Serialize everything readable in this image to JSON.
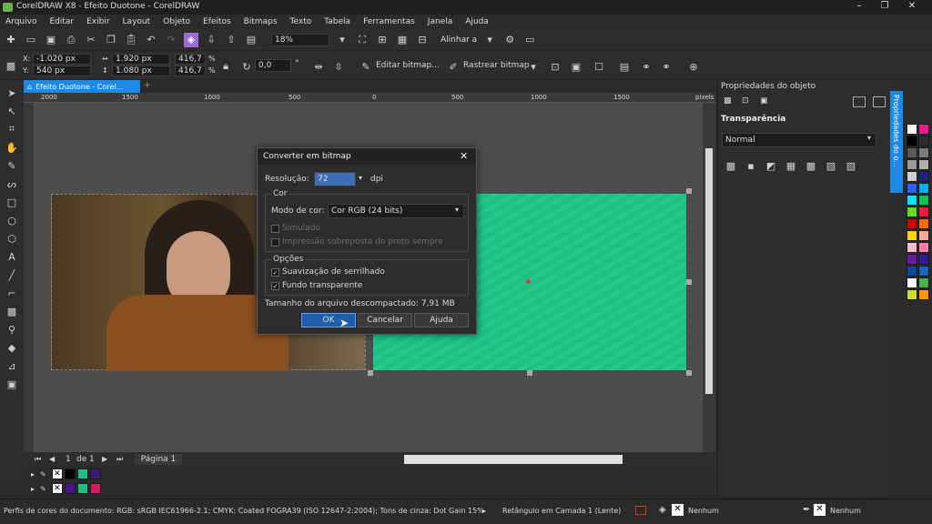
{
  "window": {
    "title": "CorelDRAW X8 - Efeito Duotone - CorelDRAW",
    "minimize": "–",
    "maximize": "❐",
    "close": "✕"
  },
  "menu": [
    "Arquivo",
    "Editar",
    "Exibir",
    "Layout",
    "Objeto",
    "Efeitos",
    "Bitmaps",
    "Texto",
    "Tabela",
    "Ferramentas",
    "Janela",
    "Ajuda"
  ],
  "toolbar": {
    "zoom": "18%",
    "align_label": "Alinhar a"
  },
  "propbar": {
    "x": "-1.020 px",
    "y": "540 px",
    "w": "1.920 px",
    "h": "1.080 px",
    "sw": "416,7",
    "sh": "416,7",
    "pct": "%",
    "rotation": "0,0",
    "deg": "°",
    "edit_bitmap": "Editar bitmap...",
    "trace_bitmap": "Rastrear bitmap"
  },
  "document_tab": "Efeito Duotone - Corel...",
  "ruler": {
    "h_ticks": [
      "2000",
      "1500",
      "1000",
      "500",
      "0",
      "500",
      "1000",
      "1500"
    ],
    "unit": "pixels"
  },
  "page_nav": {
    "current": "1",
    "of": "de",
    "total": "1",
    "page_tab": "Página 1"
  },
  "dialog": {
    "title": "Converter em bitmap",
    "resolution_label": "Resolução:",
    "resolution_value": "72",
    "resolution_unit": "dpi",
    "group_color": "Cor",
    "color_mode_label": "Modo de cor:",
    "color_mode_value": "Cor RGB (24 bits)",
    "dithered": "Simulado",
    "overprint": "Impressão sobreposta do preto sempre",
    "group_options": "Opções",
    "anti_alias": "Suavização de serrilhado",
    "transparent_bg": "Fundo transparente",
    "filesize": "Tamanho do arquivo descompactado: 7,91 MB",
    "ok": "OK",
    "cancel": "Cancelar",
    "help": "Ajuda"
  },
  "docker": {
    "title": "Propriedades do objeto",
    "section": "Transparência",
    "mode_value": "Normal",
    "vertical_tab": "Propriedades do o..."
  },
  "status": {
    "profiles": "Perfis de cores do documento: RGB: sRGB IEC61966-2.1; CMYK: Coated FOGRA39 (ISO 12647-2:2004); Tons de cinza: Dot Gain 15%",
    "selection": "Retângulo em Camada 1  (Lente)",
    "fill_none": "Nenhum",
    "outline_none": "Nenhum"
  },
  "colors": {
    "accent": "#1e88e5",
    "green_rect": "#1fbf86",
    "palette_right": [
      "#ffffff",
      "#e91e8c",
      "#000000",
      "#2e2e2e",
      "#5a5a5a",
      "#7a7a7a",
      "#9a9a9a",
      "#b0b0b0",
      "#cfcfcf",
      "#1a237e",
      "#2962ff",
      "#00b0ff",
      "#00e5ff",
      "#00c853",
      "#64dd17",
      "#ff1744",
      "#d50000",
      "#ff6d00",
      "#ffd600",
      "#ffab91",
      "#f8bbd0",
      "#ff80ab",
      "#6a1b9a",
      "#311b92",
      "#0d47a1",
      "#1565c0",
      "#ffffff",
      "#4caf50",
      "#cddc39",
      "#ff9800"
    ],
    "palette_bottom1": [
      "#ffffff",
      "#000000",
      "#1fbf86",
      "#3a1d6e"
    ],
    "palette_bottom2": [
      "#ffffff",
      "#4a148c",
      "#1fbf86",
      "#d81b60"
    ]
  }
}
